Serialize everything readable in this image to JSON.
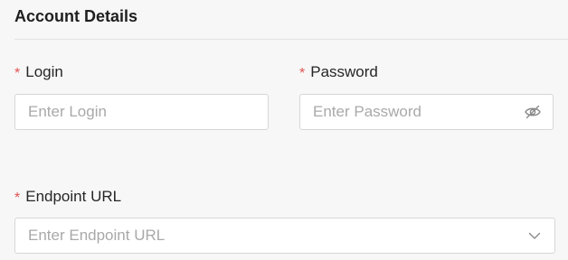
{
  "section": {
    "title": "Account Details"
  },
  "fields": {
    "login": {
      "required_mark": "*",
      "label": "Login",
      "placeholder": "Enter Login",
      "value": ""
    },
    "password": {
      "required_mark": "*",
      "label": "Password",
      "placeholder": "Enter Password",
      "value": "",
      "toggle_icon": "eye-off-icon"
    },
    "endpoint_url": {
      "required_mark": "*",
      "label": "Endpoint URL",
      "placeholder": "Enter Endpoint URL",
      "value": "",
      "dropdown_icon": "chevron-down-icon"
    }
  },
  "colors": {
    "required": "#e05252",
    "border": "#d6d6d6",
    "placeholder": "#a9a9a9",
    "background": "#f7f7f7"
  }
}
